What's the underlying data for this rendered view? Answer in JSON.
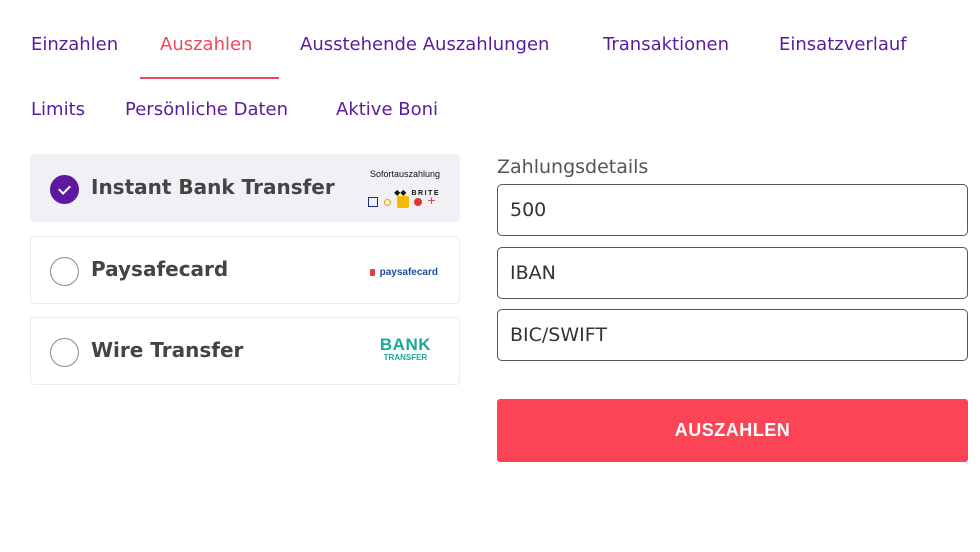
{
  "tabs": [
    {
      "label": "Einzahlen",
      "active": false
    },
    {
      "label": "Auszahlen",
      "active": true
    },
    {
      "label": "Ausstehende Auszahlungen",
      "active": false
    },
    {
      "label": "Transaktionen",
      "active": false
    },
    {
      "label": "Einsatzverlauf",
      "active": false
    },
    {
      "label": "Limits",
      "active": false
    },
    {
      "label": "Persönliche Daten",
      "active": false
    },
    {
      "label": "Aktive Boni",
      "active": false
    }
  ],
  "methods": [
    {
      "label": "Instant Bank Transfer",
      "selected": true,
      "logo": {
        "top": "Sofortauszahlung",
        "bottom": "BRITE"
      }
    },
    {
      "label": "Paysafecard",
      "selected": false,
      "logo": {
        "text": "paysafecard"
      }
    },
    {
      "label": "Wire Transfer",
      "selected": false,
      "logo": {
        "line1": "BANK",
        "line2": "TRANSFER"
      }
    }
  ],
  "details": {
    "label": "Zahlungsdetails",
    "amount_value": "500",
    "iban_placeholder": "IBAN",
    "bic_placeholder": "BIC/SWIFT"
  },
  "submit_label": "AUSZAHLEN",
  "colors": {
    "purple": "#5b1aa0",
    "accent_red": "#f0485a",
    "button_red": "#fb4556",
    "selected_bg": "#f0f1f5"
  }
}
